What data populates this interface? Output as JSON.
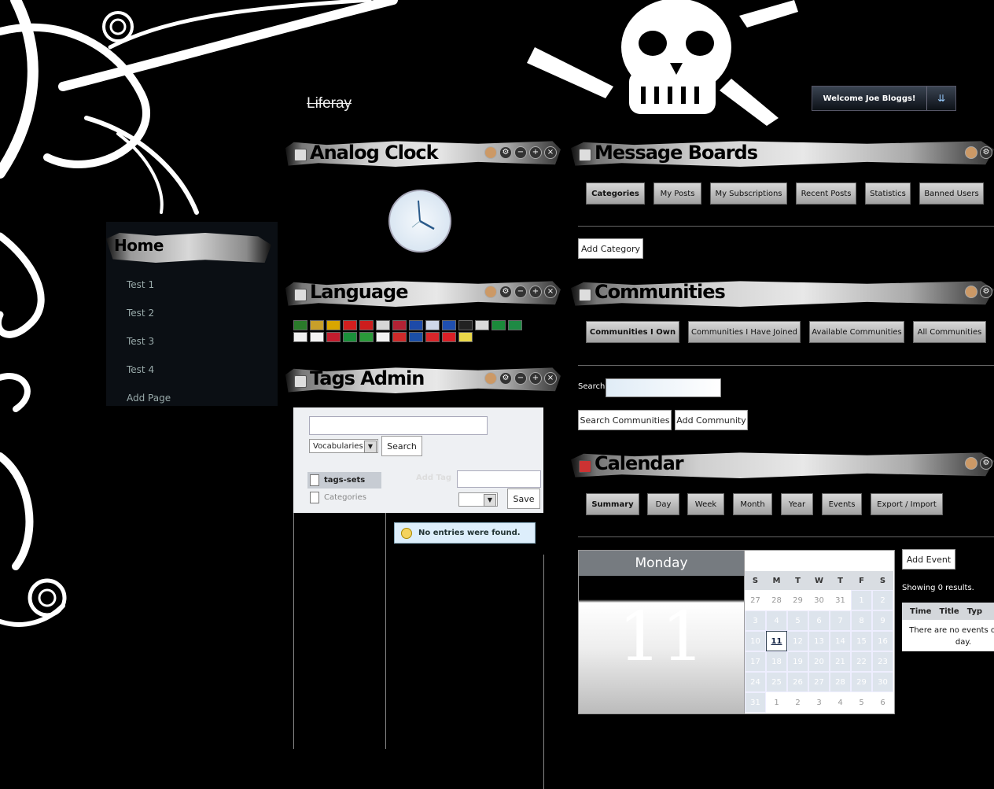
{
  "header": {
    "logo_text": "Liferay",
    "welcome": "Welcome Joe Bloggs!",
    "dock_toggle_icon": "double-chevron-down-icon"
  },
  "nav": {
    "title": "Home",
    "items": [
      "Test 1",
      "Test 2",
      "Test 3",
      "Test 4"
    ],
    "add_page": "Add Page"
  },
  "portlets": {
    "analog_clock": {
      "title": "Analog Clock"
    },
    "language": {
      "title": "Language",
      "flags": [
        "#2a7a2a",
        "#c89f2a",
        "#d9a600",
        "#d21f1f",
        "#cc1d1d",
        "#d6d6d6",
        "#b22234",
        "#1d4aa8",
        "#cfd8e8",
        "#1f4fb0",
        "#222222",
        "#d8d8d8",
        "#1a8a3a",
        "#1e8a44",
        "#f0f0f0",
        "#f3f3f3",
        "#c41d2e",
        "#1a8f3a",
        "#2a9a3a",
        "#f1f1f1",
        "#ce2a2a",
        "#1b4fa6",
        "#d8262a",
        "#d91f26",
        "#ead84a"
      ]
    },
    "tags_admin": {
      "title": "Tags Admin",
      "vocab_select": "Vocabularies",
      "search_button": "Search",
      "tree": [
        "tags-sets",
        "Categories"
      ],
      "add_tag_label": "Add Tag",
      "save_button": "Save",
      "empty_message": "No entries were found."
    },
    "message_boards": {
      "title": "Message Boards",
      "tabs": [
        "Categories",
        "My Posts",
        "My Subscriptions",
        "Recent Posts",
        "Statistics",
        "Banned Users"
      ],
      "add_category": "Add Category"
    },
    "communities": {
      "title": "Communities",
      "tabs": [
        "Communities I Own",
        "Communities I Have Joined",
        "Available Communities",
        "All Communities"
      ],
      "search_label": "Search",
      "search_button": "Search Communities",
      "add_button": "Add Community"
    },
    "calendar": {
      "title": "Calendar",
      "tabs": [
        "Summary",
        "Day",
        "Week",
        "Month",
        "Year",
        "Events",
        "Export / Import"
      ],
      "day_name": "Monday",
      "day_number": "11",
      "weekdays": [
        "S",
        "M",
        "T",
        "W",
        "T",
        "F",
        "S"
      ],
      "weeks": [
        [
          "27",
          "28",
          "29",
          "30",
          "31",
          "1",
          "2"
        ],
        [
          "3",
          "4",
          "5",
          "6",
          "7",
          "8",
          "9"
        ],
        [
          "10",
          "11",
          "12",
          "13",
          "14",
          "15",
          "16"
        ],
        [
          "17",
          "18",
          "19",
          "20",
          "21",
          "22",
          "23"
        ],
        [
          "24",
          "25",
          "26",
          "27",
          "28",
          "29",
          "30"
        ],
        [
          "31",
          "1",
          "2",
          "3",
          "4",
          "5",
          "6"
        ]
      ],
      "add_event": "Add Event",
      "showing": "Showing 0 results.",
      "columns": [
        "Time",
        "Title",
        "Typ"
      ],
      "empty_message": "There are no events on this day."
    }
  }
}
